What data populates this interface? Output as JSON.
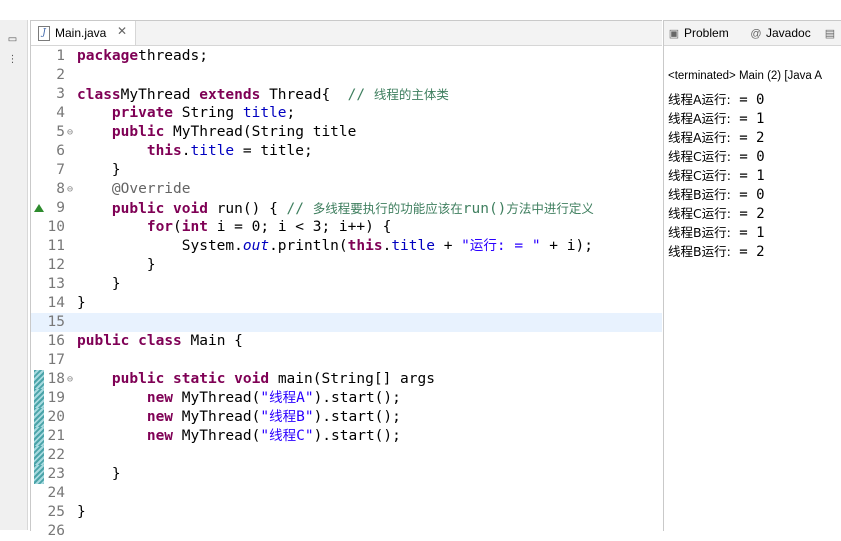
{
  "editor": {
    "tab_label": "Main.java",
    "tab_close": "✕",
    "tab_icon": "J"
  },
  "lines": [
    {
      "n": "1",
      "fold": "",
      "marker": "",
      "segs": [
        [
          "kw",
          "package"
        ],
        [
          "",
          "threads;"
        ]
      ]
    },
    {
      "n": "2",
      "fold": "",
      "marker": "",
      "segs": []
    },
    {
      "n": "3",
      "fold": "",
      "marker": "",
      "segs": [
        [
          "kw",
          "class"
        ],
        [
          "",
          "MyThread"
        ],
        [
          "kw",
          " extends"
        ],
        [
          "",
          " Thread{  "
        ],
        [
          "cm",
          "// "
        ],
        [
          "cm cn",
          "线程的主体类"
        ]
      ]
    },
    {
      "n": "4",
      "fold": "",
      "marker": "",
      "segs": [
        [
          "",
          "    "
        ],
        [
          "kw",
          "private"
        ],
        [
          "",
          " String "
        ],
        [
          "fld",
          "title"
        ],
        [
          "",
          ";"
        ]
      ]
    },
    {
      "n": "5",
      "fold": "⊖",
      "marker": "",
      "segs": [
        [
          "",
          "    "
        ],
        [
          "kw",
          "public"
        ],
        [
          "",
          " MyThread(String "
        ],
        [
          "",
          "title"
        ],
        [
          ") {"
        ]
      ]
    },
    {
      "n": "6",
      "fold": "",
      "marker": "",
      "segs": [
        [
          "",
          "        "
        ],
        [
          "kw",
          "this"
        ],
        [
          "",
          "."
        ],
        [
          "fld",
          "title"
        ],
        [
          "",
          " = "
        ],
        [
          "",
          "title"
        ],
        [
          "",
          ";"
        ]
      ]
    },
    {
      "n": "7",
      "fold": "",
      "marker": "",
      "segs": [
        [
          "",
          "    }"
        ]
      ]
    },
    {
      "n": "8",
      "fold": "⊖",
      "marker": "",
      "segs": [
        [
          "",
          "    "
        ],
        [
          "ann",
          "@Override"
        ]
      ]
    },
    {
      "n": "9",
      "fold": "",
      "marker": "override",
      "segs": [
        [
          "",
          "    "
        ],
        [
          "kw",
          "public"
        ],
        [
          "",
          " "
        ],
        [
          "kw",
          "void"
        ],
        [
          "",
          " run() { "
        ],
        [
          "cm",
          "// "
        ],
        [
          "cm cn",
          "多线程要执行的功能应该在"
        ],
        [
          "cm",
          "run()"
        ],
        [
          "cm cn",
          "方法中进行定义"
        ]
      ]
    },
    {
      "n": "10",
      "fold": "",
      "marker": "",
      "segs": [
        [
          "",
          "        "
        ],
        [
          "kw",
          "for"
        ],
        [
          "",
          "("
        ],
        [
          "kw",
          "int"
        ],
        [
          "",
          " i = 0; i < 3; i++) {"
        ]
      ]
    },
    {
      "n": "11",
      "fold": "",
      "marker": "",
      "segs": [
        [
          "",
          "            System."
        ],
        [
          "fld it",
          "out"
        ],
        [
          "",
          ".println("
        ],
        [
          "kw",
          "this"
        ],
        [
          "",
          "."
        ],
        [
          "fld",
          "title"
        ],
        [
          "",
          " + "
        ],
        [
          "str",
          "\""
        ],
        [
          "str cn14",
          "运行"
        ],
        [
          "str",
          ": = \""
        ],
        [
          "",
          " + i);"
        ]
      ]
    },
    {
      "n": "12",
      "fold": "",
      "marker": "",
      "segs": [
        [
          "",
          "        }"
        ]
      ]
    },
    {
      "n": "13",
      "fold": "",
      "marker": "",
      "segs": [
        [
          "",
          "    }"
        ]
      ]
    },
    {
      "n": "14",
      "fold": "",
      "marker": "",
      "segs": [
        [
          "",
          "}"
        ]
      ]
    },
    {
      "n": "15",
      "fold": "",
      "marker": "",
      "current": true,
      "segs": []
    },
    {
      "n": "16",
      "fold": "",
      "marker": "",
      "segs": [
        [
          "kw",
          "public"
        ],
        [
          "",
          " "
        ],
        [
          "kw",
          "class"
        ],
        [
          "",
          " Main {"
        ]
      ]
    },
    {
      "n": "17",
      "fold": "",
      "marker": "",
      "segs": []
    },
    {
      "n": "18",
      "fold": "⊖",
      "marker": "change",
      "segs": [
        [
          "",
          "    "
        ],
        [
          "kw",
          "public"
        ],
        [
          "",
          " "
        ],
        [
          "kw",
          "static"
        ],
        [
          "",
          " "
        ],
        [
          "kw",
          "void"
        ],
        [
          "",
          " main(String[] "
        ],
        [
          "",
          "args"
        ],
        [
          ") {"
        ]
      ]
    },
    {
      "n": "19",
      "fold": "",
      "marker": "change",
      "segs": [
        [
          "",
          "        "
        ],
        [
          "kw",
          "new"
        ],
        [
          "",
          " MyThread("
        ],
        [
          "str",
          "\""
        ],
        [
          "str cn14",
          "线程"
        ],
        [
          "str",
          "A\""
        ],
        [
          "",
          ").start();"
        ]
      ]
    },
    {
      "n": "20",
      "fold": "",
      "marker": "change",
      "segs": [
        [
          "",
          "        "
        ],
        [
          "kw",
          "new"
        ],
        [
          "",
          " MyThread("
        ],
        [
          "str",
          "\""
        ],
        [
          "str cn14",
          "线程"
        ],
        [
          "str",
          "B\""
        ],
        [
          "",
          ").start();"
        ]
      ]
    },
    {
      "n": "21",
      "fold": "",
      "marker": "change",
      "segs": [
        [
          "",
          "        "
        ],
        [
          "kw",
          "new"
        ],
        [
          "",
          " MyThread("
        ],
        [
          "str",
          "\""
        ],
        [
          "str cn14",
          "线程"
        ],
        [
          "str",
          "C\""
        ],
        [
          "",
          ").start();"
        ]
      ]
    },
    {
      "n": "22",
      "fold": "",
      "marker": "change",
      "segs": []
    },
    {
      "n": "23",
      "fold": "",
      "marker": "change",
      "segs": [
        [
          "",
          "    }"
        ]
      ]
    },
    {
      "n": "24",
      "fold": "",
      "marker": "",
      "segs": []
    },
    {
      "n": "25",
      "fold": "",
      "marker": "",
      "segs": [
        [
          "",
          "}"
        ]
      ]
    },
    {
      "n": "26",
      "fold": "",
      "marker": "",
      "segs": []
    }
  ],
  "console": {
    "tabs": [
      {
        "icon": "problems-icon",
        "glyph": "▣",
        "label": "Problem"
      },
      {
        "icon": "javadoc-icon",
        "glyph": "@",
        "label": "Javadoc"
      },
      {
        "icon": "declaration-icon",
        "glyph": "▤",
        "label": ""
      }
    ],
    "status": "<terminated> Main (2) [Java A",
    "output": [
      {
        "prefix": "线程A运行:",
        "value": " = 0"
      },
      {
        "prefix": "线程A运行:",
        "value": " = 1"
      },
      {
        "prefix": "线程A运行:",
        "value": " = 2"
      },
      {
        "prefix": "线程C运行:",
        "value": " = 0"
      },
      {
        "prefix": "线程C运行:",
        "value": " = 1"
      },
      {
        "prefix": "线程B运行:",
        "value": " = 0"
      },
      {
        "prefix": "线程C运行:",
        "value": " = 2"
      },
      {
        "prefix": "线程B运行:",
        "value": " = 1"
      },
      {
        "prefix": "线程B运行:",
        "value": " = 2"
      }
    ]
  }
}
